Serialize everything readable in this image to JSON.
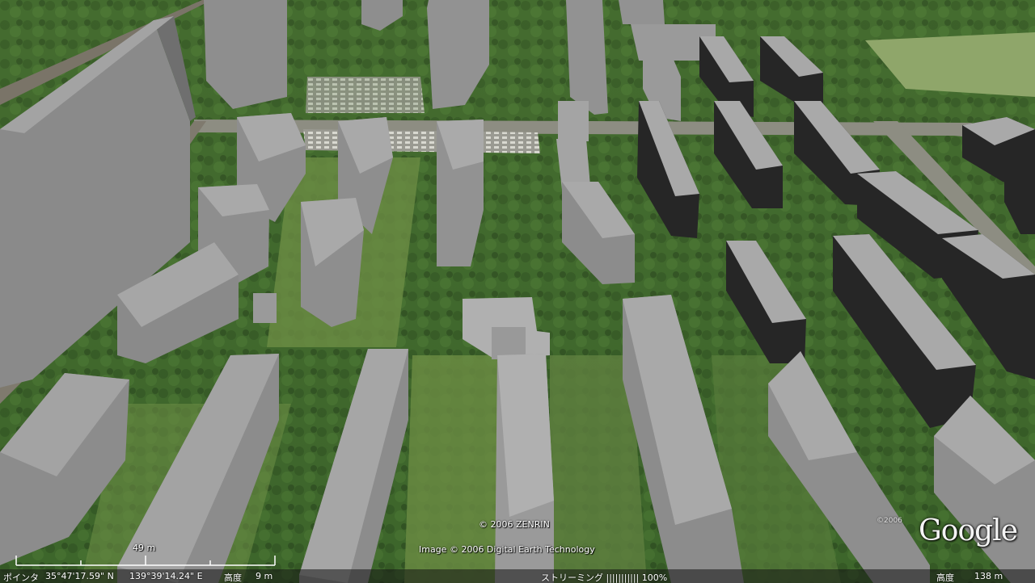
{
  "map": {
    "attribution_zenrin": "© 2006 ZENRIN",
    "attribution_image": "Image © 2006 Digital Earth Technology",
    "google_year": "©2006",
    "google_logo": "Google",
    "scale_label": "49 m"
  },
  "status_bar": {
    "pointer_label": "ポインタ",
    "latitude": "35°47'17.59\"  N",
    "longitude": "139°39'14.24\"  E",
    "elevation_label": "高度",
    "elevation_value": "9 m",
    "streaming_text": "ストリーミング ||||||||||| 100%",
    "eye_alt_label": "高度",
    "eye_alt_value": "138 m"
  },
  "colors": {
    "roof": "#a8a8a8",
    "wall_lit": "#8c8c8c",
    "wall_shadow": "#2a2a2a",
    "grass": "#5a7a3a",
    "tree": "#2f5a22",
    "road": "#8d8d82"
  }
}
